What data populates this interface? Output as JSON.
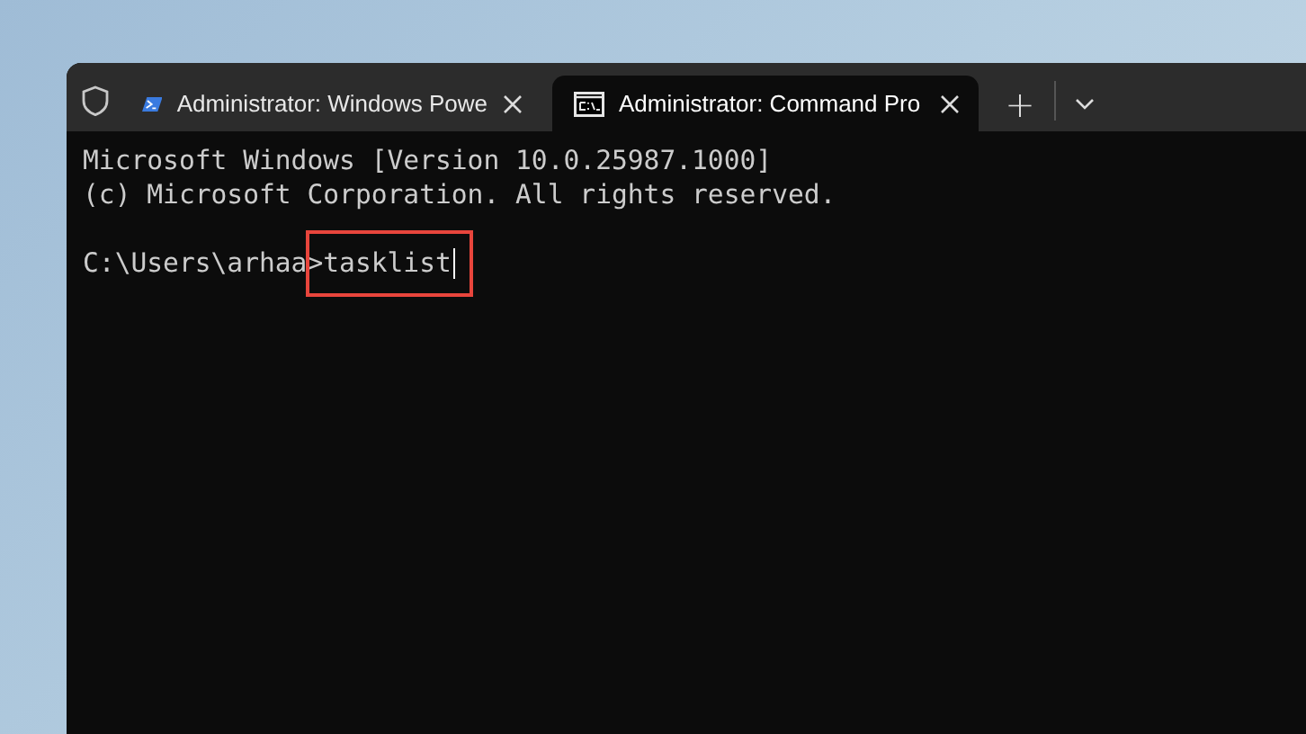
{
  "tabs": [
    {
      "kind": "powershell",
      "title": "Administrator: Windows Powe",
      "selected": false
    },
    {
      "kind": "cmd",
      "title": "Administrator: Command Pro",
      "selected": true
    }
  ],
  "new_tab": "+",
  "console": {
    "output": [
      "Microsoft Windows [Version 10.0.25987.1000]",
      "(c) Microsoft Corporation. All rights reserved."
    ],
    "prompt": {
      "path": "C:\\Users\\arhaa",
      "command": ">tasklist",
      "highlighted": true,
      "cursor": true
    }
  }
}
